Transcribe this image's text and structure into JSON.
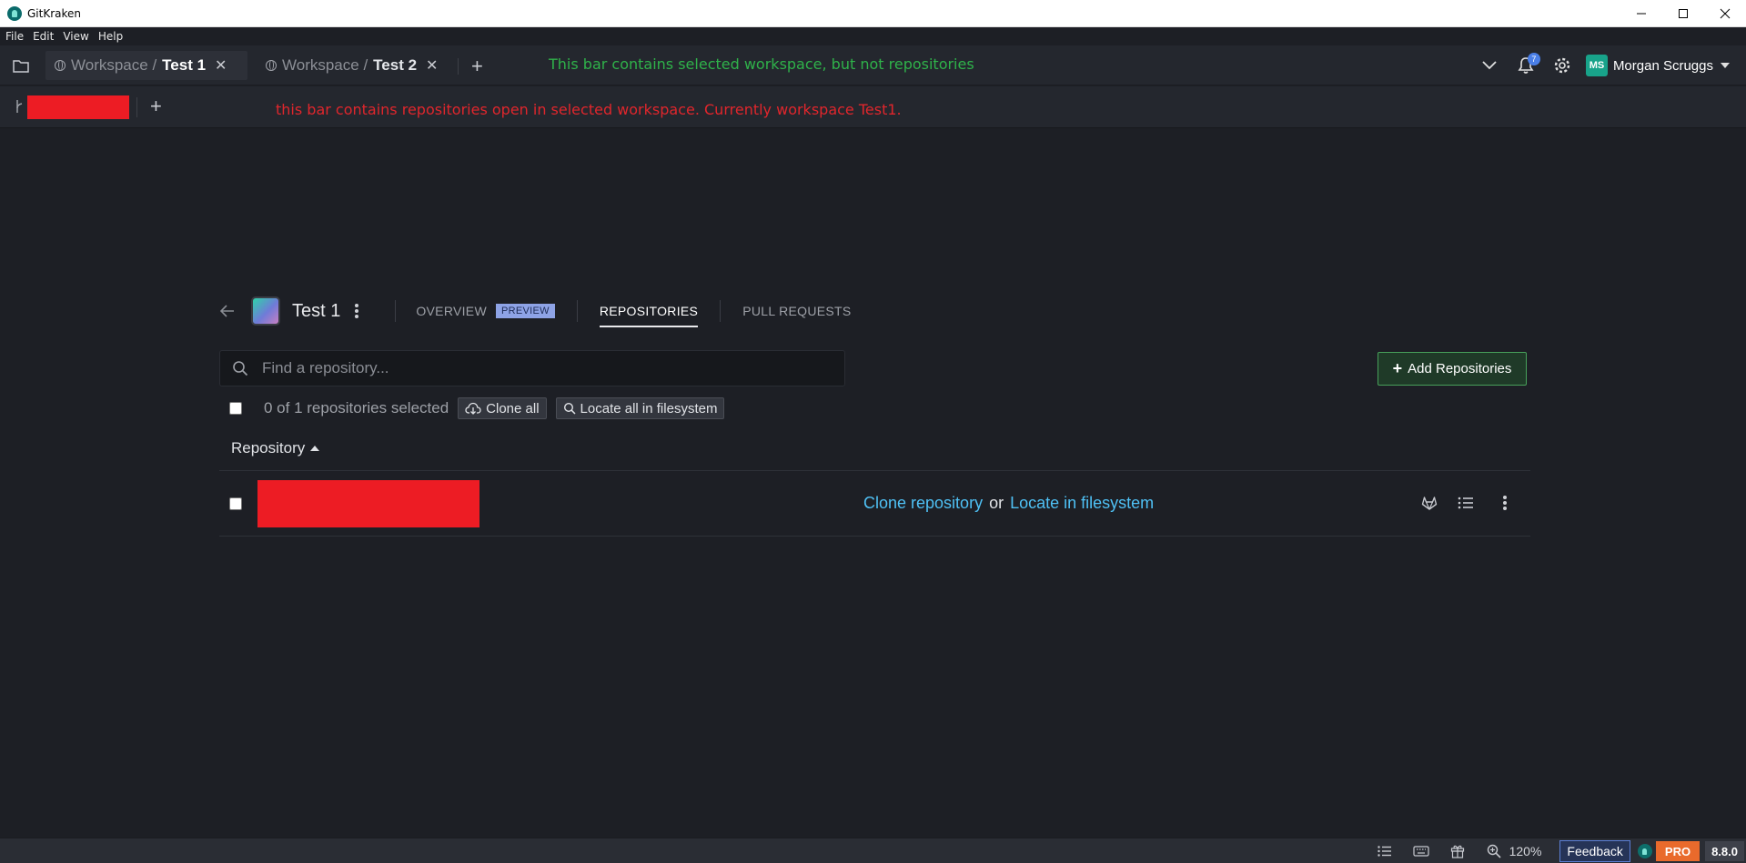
{
  "window": {
    "title": "GitKraken"
  },
  "menu": [
    "File",
    "Edit",
    "View",
    "Help"
  ],
  "workspace_tabs": [
    {
      "prefix": "Workspace /",
      "name": "Test 1",
      "active": true
    },
    {
      "prefix": "Workspace /",
      "name": "Test 2",
      "active": false
    }
  ],
  "annotations": {
    "workspace_bar": "This bar contains selected workspace, but not repositories",
    "repo_bar": "this bar contains repositories open in selected workspace.  Currently workspace Test1."
  },
  "toolbar": {
    "notification_count": "7",
    "user_initials": "MS",
    "user_name": "Morgan Scruggs"
  },
  "workspace": {
    "title": "Test 1",
    "tabs": [
      {
        "label": "OVERVIEW",
        "badge": "PREVIEW"
      },
      {
        "label": "REPOSITORIES"
      },
      {
        "label": "PULL REQUESTS"
      }
    ]
  },
  "search": {
    "placeholder": "Find a repository..."
  },
  "add_button_label": "Add Repositories",
  "selection": {
    "text": "0 of 1 repositories selected",
    "clone_all": "Clone all",
    "locate_all": "Locate all in filesystem"
  },
  "table": {
    "column_header": "Repository",
    "rows": [
      {
        "clone_link": "Clone repository",
        "or_text": "or",
        "locate_link": "Locate in filesystem"
      }
    ]
  },
  "statusbar": {
    "zoom": "120%",
    "feedback": "Feedback",
    "pro": "PRO",
    "version": "8.8.0"
  },
  "colors": {
    "annotation_green": "#2fb24a",
    "annotation_red": "#e0262c",
    "link_blue": "#4fc1f5",
    "add_button_border": "#47a05a",
    "pro_orange": "#e96a2c",
    "redaction_red": "#ed1c24"
  }
}
